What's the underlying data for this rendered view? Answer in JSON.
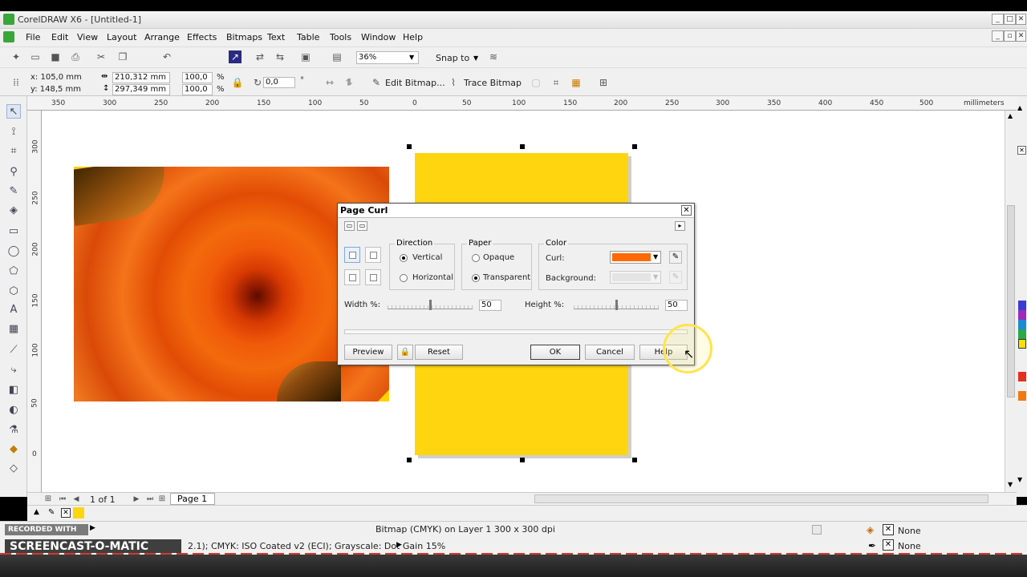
{
  "app": {
    "title": "CorelDRAW X6 - [Untitled-1]"
  },
  "menu": [
    "File",
    "Edit",
    "View",
    "Layout",
    "Arrange",
    "Effects",
    "Bitmaps",
    "Text",
    "Table",
    "Tools",
    "Window",
    "Help"
  ],
  "toolbar": {
    "zoom": "36%",
    "snap_to": "Snap to"
  },
  "propbar": {
    "x": "x: 105,0 mm",
    "y": "y: 148,5 mm",
    "w": "210,312 mm",
    "h": "297,349 mm",
    "sx": "100,0",
    "sy": "100,0",
    "pct": "%",
    "angle": "0,0",
    "deg": "°",
    "edit_bitmap": "Edit Bitmap...",
    "trace_bitmap": "Trace Bitmap"
  },
  "ruler": {
    "h": [
      "350",
      "300",
      "250",
      "200",
      "150",
      "100",
      "50",
      "0",
      "50",
      "100",
      "150",
      "200",
      "250",
      "300",
      "350",
      "400",
      "450",
      "500"
    ],
    "units": "millimeters",
    "v": [
      "300",
      "250",
      "200",
      "150",
      "100",
      "50",
      "0"
    ],
    "vunits": "millimeters"
  },
  "pagebar": {
    "count": "1 of 1",
    "tab": "Page 1"
  },
  "dialog": {
    "title": "Page Curl",
    "direction": {
      "title": "Direction",
      "vertical": "Vertical",
      "horizontal": "Horizontal"
    },
    "paper": {
      "title": "Paper",
      "opaque": "Opaque",
      "transparent": "Transparent"
    },
    "color": {
      "title": "Color",
      "curl": "Curl:",
      "background": "Background:"
    },
    "width_label": "Width %:",
    "width_value": "50",
    "height_label": "Height %:",
    "height_value": "50",
    "preview": "Preview",
    "reset": "Reset",
    "ok": "OK",
    "cancel": "Cancel",
    "help": "Help"
  },
  "status": {
    "object": "Bitmap (CMYK) on Layer 1 300 x 300 dpi",
    "profiles": "2.1); CMYK: ISO Coated v2 (ECI); Grayscale: Dot Gain 15%",
    "recorded": "RECORDED WITH",
    "brand": "SCREENCAST-O-MATIC",
    "fill": "None",
    "outline": "None"
  },
  "colors": {
    "curl": "#ff6a00",
    "yellow": "#ffd510"
  }
}
